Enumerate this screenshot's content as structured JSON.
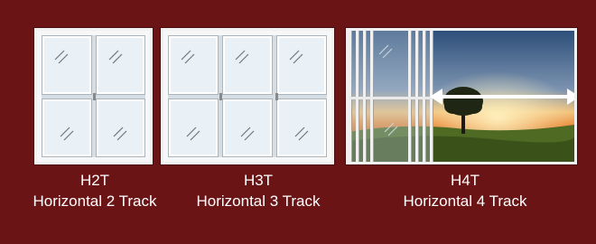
{
  "products": [
    {
      "code": "H2T",
      "name": "Horizontal 2 Track"
    },
    {
      "code": "H3T",
      "name": "Horizontal 3 Track"
    },
    {
      "code": "H4T",
      "name": "Horizontal 4 Track"
    }
  ],
  "colors": {
    "background": "#6b1416",
    "frame": "#f1f1f1",
    "glass": "#e9f0f6",
    "label_text": "#ffffff"
  },
  "icons": [
    "glass-glint-icon",
    "double-arrow-icon"
  ]
}
